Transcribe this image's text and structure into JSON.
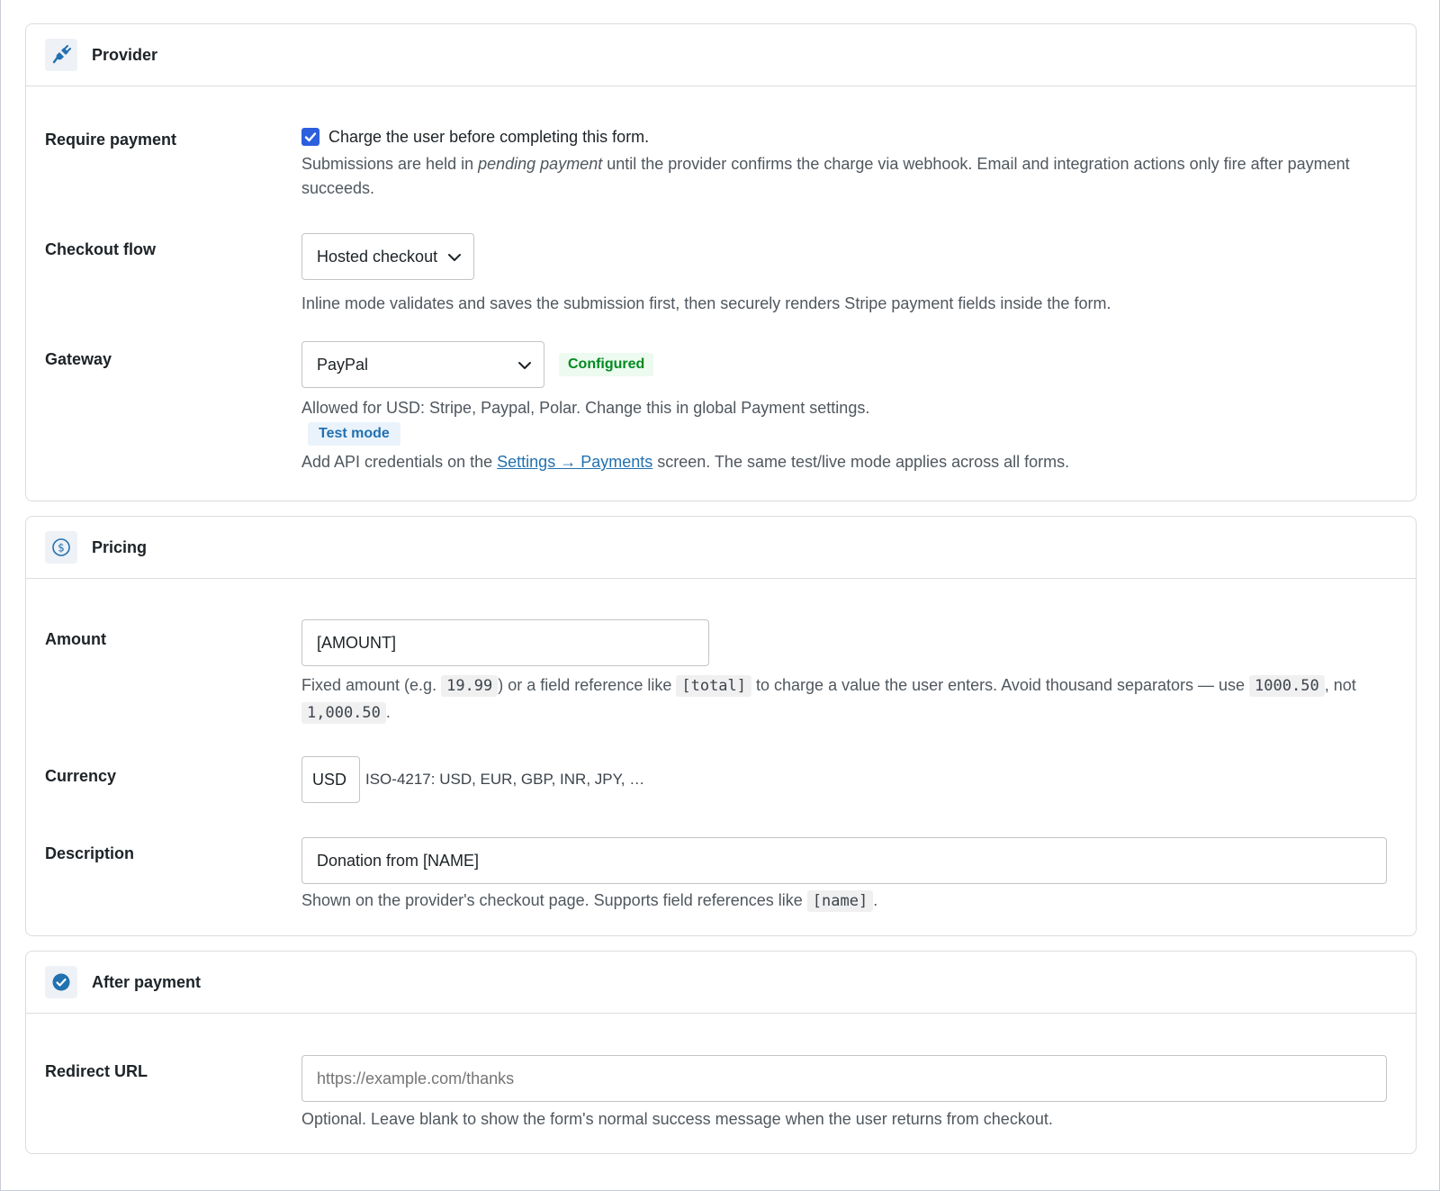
{
  "provider": {
    "title": "Provider",
    "icon": "plug-icon",
    "require_payment": {
      "label": "Require payment",
      "checked": true,
      "checkbox_label": "Charge the user before completing this form.",
      "help_pre": "Submissions are held in ",
      "help_em": "pending payment",
      "help_post": " until the provider confirms the charge via webhook. Email and integration actions only fire after payment succeeds."
    },
    "checkout_flow": {
      "label": "Checkout flow",
      "value": "Hosted checkout",
      "help": "Inline mode validates and saves the submission first, then securely renders Stripe payment fields inside the form."
    },
    "gateway": {
      "label": "Gateway",
      "value": "PayPal",
      "status_badge": "Configured",
      "allowed_help": "Allowed for USD: Stripe, Paypal, Polar. Change this in global Payment settings.",
      "mode_badge": "Test mode",
      "credentials_pre": "Add API credentials on the ",
      "credentials_link": "Settings → Payments",
      "credentials_post": " screen. The same test/live mode applies across all forms."
    }
  },
  "pricing": {
    "title": "Pricing",
    "icon": "dollar-circle-icon",
    "amount": {
      "label": "Amount",
      "value": "[AMOUNT]",
      "help_1": "Fixed amount (e.g. ",
      "code_1": "19.99",
      "help_2": ") or a field reference like ",
      "code_2": "[total]",
      "help_3": " to charge a value the user enters. Avoid thousand separators — use ",
      "code_3": "1000.50",
      "help_4": ", not ",
      "code_4": "1,000.50",
      "help_5": "."
    },
    "currency": {
      "label": "Currency",
      "value": "USD",
      "hint": "ISO-4217: USD, EUR, GBP, INR, JPY, …"
    },
    "description": {
      "label": "Description",
      "value": "Donation from [NAME]",
      "help_pre": "Shown on the provider's checkout page. Supports field references like ",
      "help_code": "[name]",
      "help_post": "."
    }
  },
  "after_payment": {
    "title": "After payment",
    "icon": "check-circle-icon",
    "redirect": {
      "label": "Redirect URL",
      "placeholder": "https://example.com/thanks",
      "help": "Optional. Leave blank to show the form's normal success message when the user returns from checkout."
    }
  },
  "colors": {
    "accent": "#2271b1",
    "checkbox": "#2c5fde",
    "success": "#008a20"
  }
}
